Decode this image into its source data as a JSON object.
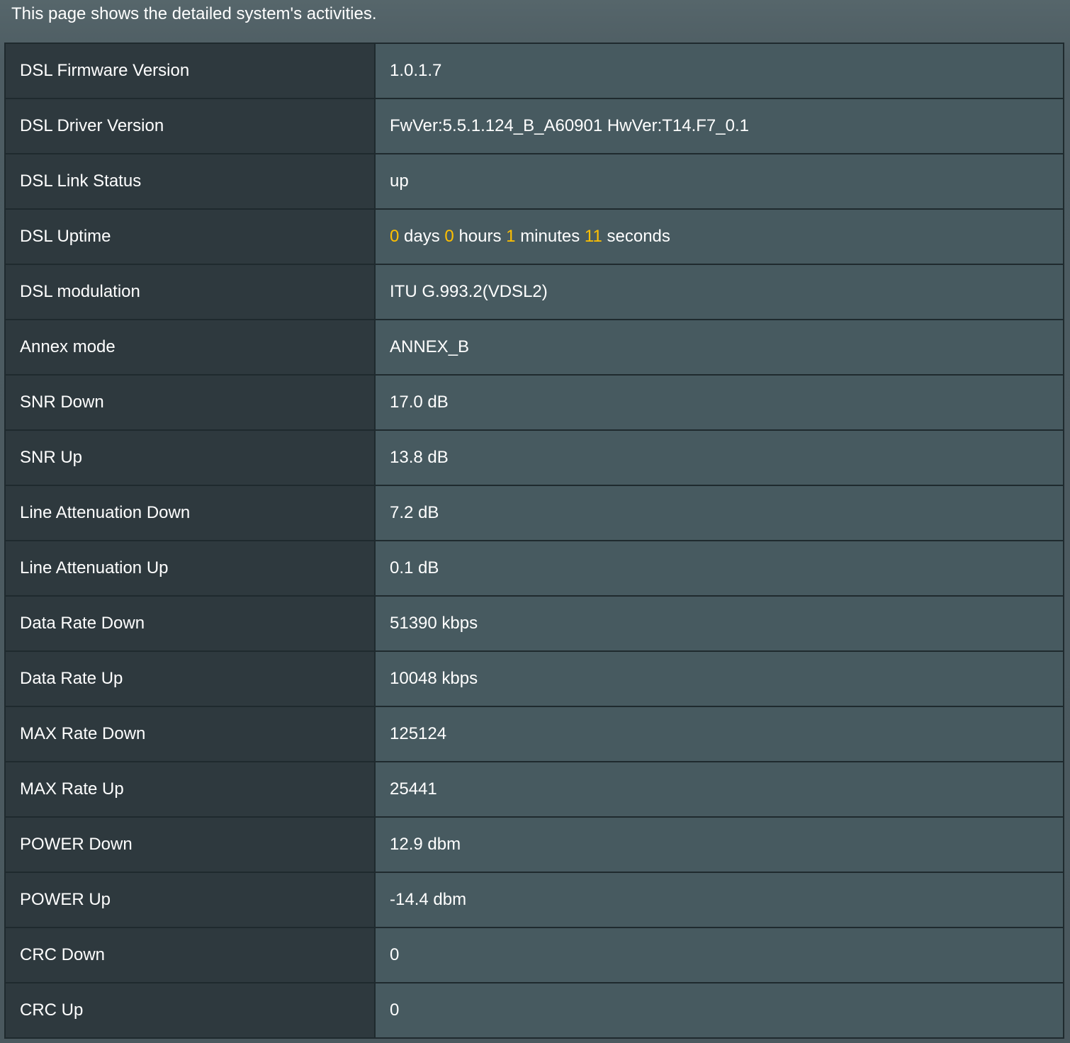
{
  "page": {
    "description": "This page shows the detailed system's activities."
  },
  "accent_color": "#ffc000",
  "rows": [
    {
      "label": "DSL Firmware Version",
      "value": "1.0.1.7"
    },
    {
      "label": "DSL Driver Version",
      "value": "FwVer:5.5.1.124_B_A60901 HwVer:T14.F7_0.1"
    },
    {
      "label": "DSL Link Status",
      "value": "up"
    },
    {
      "label": "DSL Uptime",
      "uptime": {
        "days": "0",
        "days_unit": "days",
        "hours": "0",
        "hours_unit": "hours",
        "minutes": "1",
        "minutes_unit": "minutes",
        "seconds": "11",
        "seconds_unit": "seconds"
      }
    },
    {
      "label": "DSL modulation",
      "value": "ITU G.993.2(VDSL2)"
    },
    {
      "label": "Annex mode",
      "value": "ANNEX_B"
    },
    {
      "label": "SNR Down",
      "value": "17.0 dB"
    },
    {
      "label": "SNR Up",
      "value": "13.8 dB"
    },
    {
      "label": "Line Attenuation Down",
      "value": "7.2 dB"
    },
    {
      "label": "Line Attenuation Up",
      "value": "0.1 dB"
    },
    {
      "label": "Data Rate Down",
      "value": "51390 kbps"
    },
    {
      "label": "Data Rate Up",
      "value": "10048 kbps"
    },
    {
      "label": "MAX Rate Down",
      "value": "125124"
    },
    {
      "label": "MAX Rate Up",
      "value": "25441"
    },
    {
      "label": "POWER Down",
      "value": "12.9 dbm"
    },
    {
      "label": "POWER Up",
      "value": "-14.4 dbm"
    },
    {
      "label": "CRC Down",
      "value": "0"
    },
    {
      "label": "CRC Up",
      "value": "0"
    }
  ]
}
